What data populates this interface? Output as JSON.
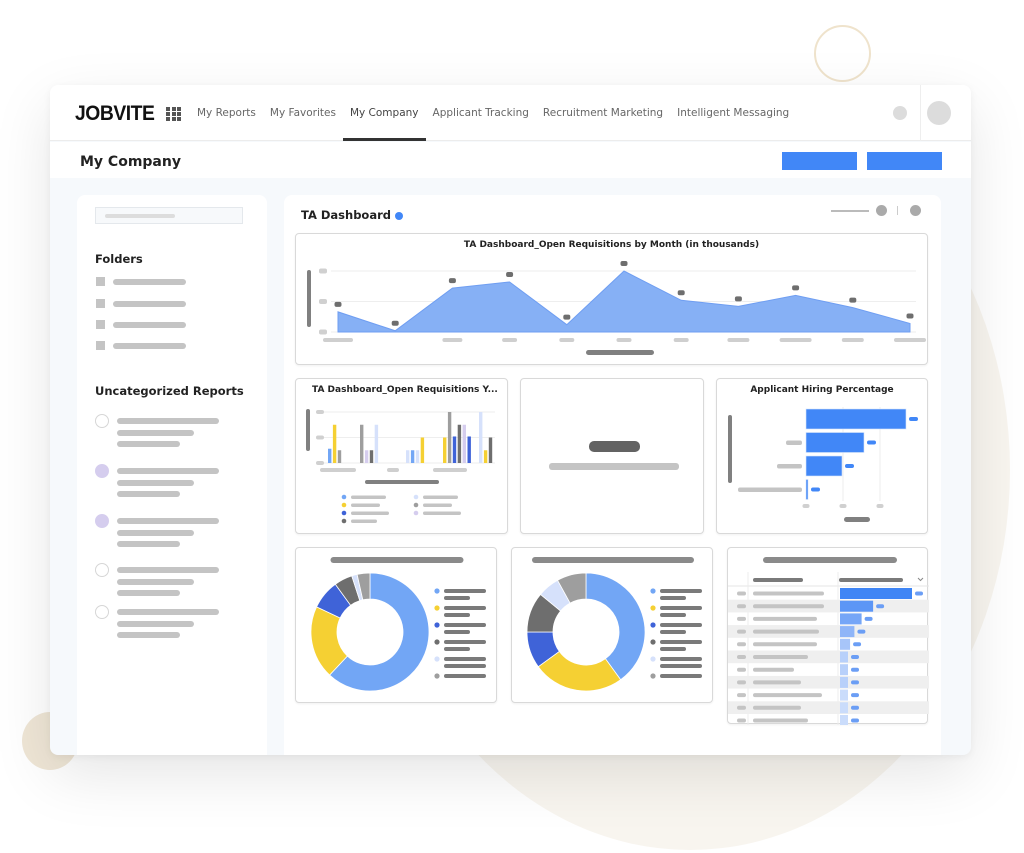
{
  "app": {
    "logo": "JOBVITE",
    "nav": [
      {
        "label": "My Reports",
        "active": false
      },
      {
        "label": "My Favorites",
        "active": false
      },
      {
        "label": "My Company",
        "active": true
      },
      {
        "label": "Applicant Tracking",
        "active": false
      },
      {
        "label": "Recruitment Marketing",
        "active": false
      },
      {
        "label": "Intelligent Messaging",
        "active": false
      }
    ]
  },
  "header": {
    "page_title": "My Company",
    "accent_color": "#4187f7"
  },
  "sidebar": {
    "folders_heading": "Folders",
    "folder_count": 4,
    "uncategorized_heading": "Uncategorized Reports",
    "reports": [
      {
        "selected": false
      },
      {
        "selected": true
      },
      {
        "selected": true
      },
      {
        "selected": false
      },
      {
        "selected": false
      }
    ]
  },
  "dashboard": {
    "title": "TA Dashboard",
    "status_color": "#4187f7"
  },
  "chart_data": [
    {
      "type": "area",
      "title": "TA Dashboard_Open Requisitions by Month (in thousands)",
      "x": [
        1,
        2,
        3,
        4,
        5,
        6,
        7,
        8,
        9,
        10,
        11
      ],
      "values": [
        33,
        2,
        72,
        82,
        12,
        100,
        52,
        42,
        60,
        40,
        14
      ],
      "ylim": [
        0,
        100
      ],
      "grid": true,
      "color": "#86b0f5"
    },
    {
      "type": "bar",
      "title": "TA Dashboard_Open Requisitions Y...",
      "series_colors": [
        "#72a6f5",
        "#f5d033",
        "#3f63d8",
        "#6e6e6e",
        "#d6e1fb",
        "#9e9e9e",
        "#d5cdee"
      ],
      "groups": [
        [
          {
            "s": 0,
            "v": 28
          },
          {
            "s": 1,
            "v": 75
          },
          {
            "s": 5,
            "v": 25
          }
        ],
        [
          {
            "s": 5,
            "v": 75
          },
          {
            "s": 6,
            "v": 25
          },
          {
            "s": 3,
            "v": 25
          },
          {
            "s": 4,
            "v": 75
          }
        ],
        [
          {
            "s": 4,
            "v": 25
          },
          {
            "s": 0,
            "v": 25
          },
          {
            "s": 4,
            "v": 25
          },
          {
            "s": 1,
            "v": 50
          }
        ],
        [
          {
            "s": 1,
            "v": 50
          },
          {
            "s": 5,
            "v": 100
          },
          {
            "s": 2,
            "v": 52
          },
          {
            "s": 3,
            "v": 75
          },
          {
            "s": 6,
            "v": 75
          },
          {
            "s": 2,
            "v": 52
          }
        ],
        [
          {
            "s": 4,
            "v": 100
          },
          {
            "s": 1,
            "v": 25
          },
          {
            "s": 3,
            "v": 50
          }
        ]
      ],
      "ylim": [
        0,
        100
      ],
      "legend": "bottom",
      "legend_count": 7
    },
    {
      "type": "bar",
      "orientation": "horizontal",
      "title": "Applicant Hiring Percentage",
      "values": [
        100,
        58,
        36,
        1
      ],
      "xlim": [
        0,
        100
      ],
      "color": "#4187f7"
    },
    {
      "type": "pie",
      "donut": true,
      "values": [
        62,
        20,
        8,
        5,
        1.5,
        3.5
      ],
      "colors": [
        "#72a6f5",
        "#f5d033",
        "#3f63d8",
        "#6e6e6e",
        "#d6e1fb",
        "#9e9e9e"
      ],
      "legend": "right"
    },
    {
      "type": "pie",
      "donut": true,
      "values": [
        40,
        25,
        10,
        11,
        6,
        8
      ],
      "colors": [
        "#72a6f5",
        "#f5d033",
        "#3f63d8",
        "#6e6e6e",
        "#d6e1fb",
        "#9e9e9e"
      ],
      "legend": "right"
    },
    {
      "type": "table",
      "rows": 11,
      "bar_values": [
        100,
        46,
        30,
        20,
        14,
        11,
        11,
        11,
        9,
        9,
        9
      ],
      "bar_color": "#4187f7"
    }
  ]
}
